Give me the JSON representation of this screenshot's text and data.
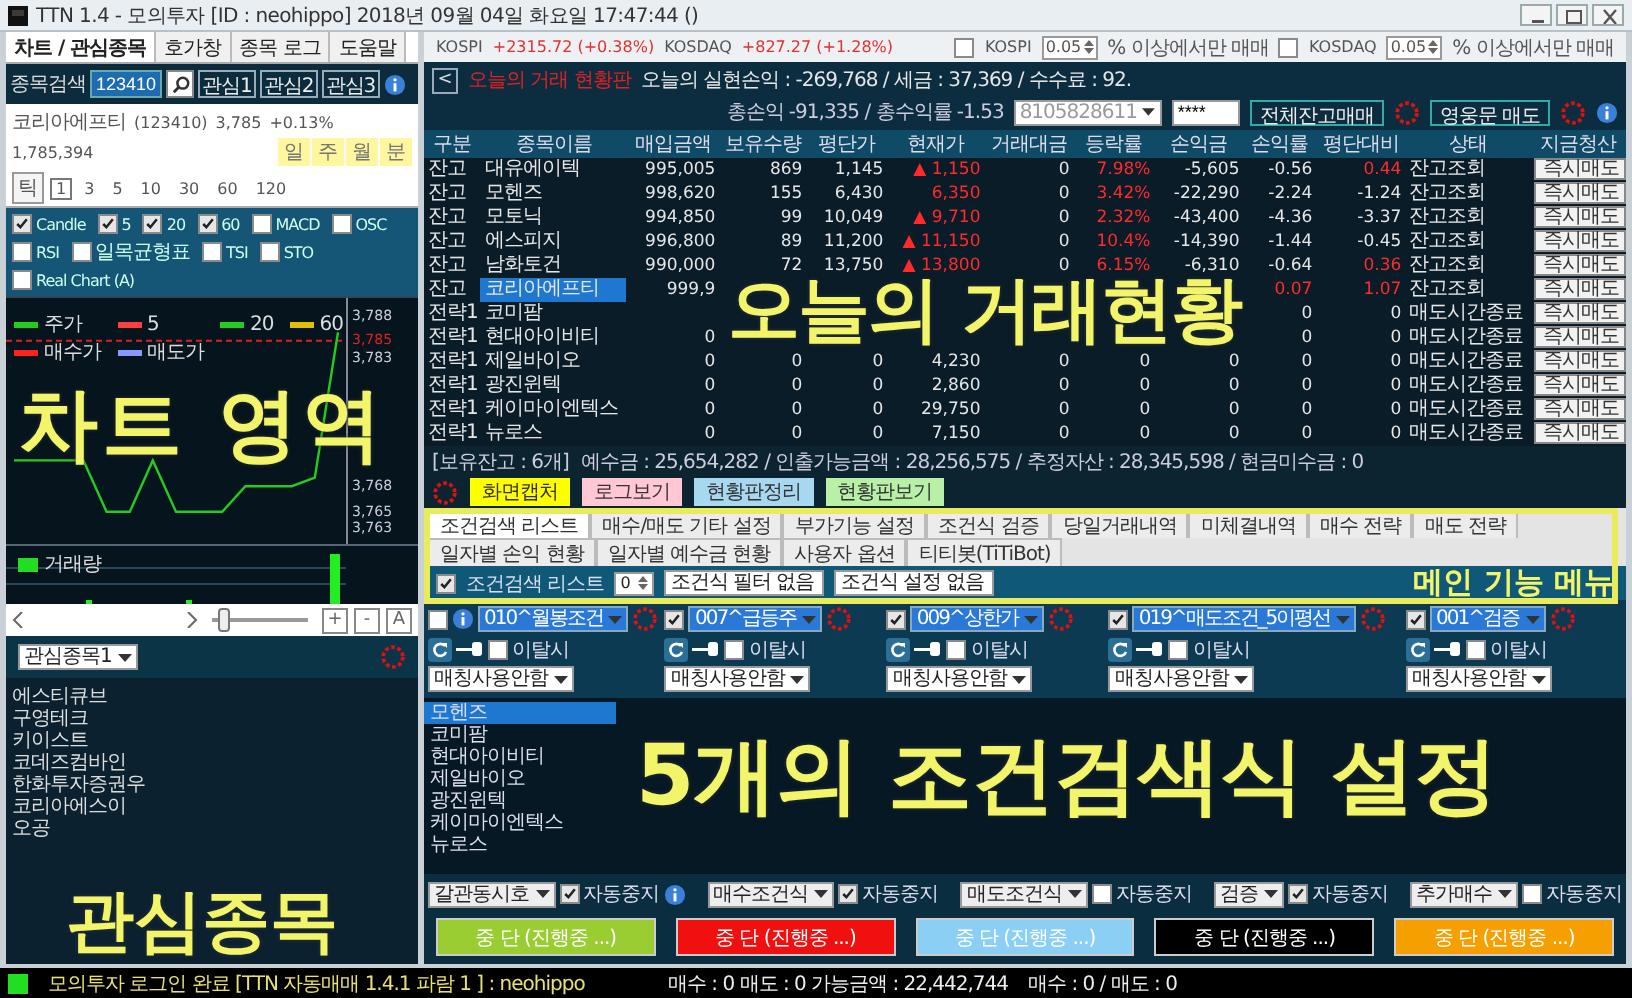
{
  "window": {
    "title": "TTN 1.4 - 모의투자 [ID : neohippo] 2018년 09월 04일 화요일 17:47:44 ()"
  },
  "left_tabs": [
    {
      "label": "차트 / 관심종목",
      "selected": true
    },
    {
      "label": "호가창",
      "selected": false
    },
    {
      "label": "종목 로그",
      "selected": false
    },
    {
      "label": "도움말",
      "selected": false
    }
  ],
  "stock_search": {
    "label": "종목검색",
    "value": "123410",
    "buttons": [
      "관심1",
      "관심2",
      "관심3"
    ]
  },
  "stock_info": {
    "name": "코리아에프티",
    "code": "(123410)",
    "price": "3,785",
    "change": "+0.13%",
    "volume": "1,785,394",
    "periods": [
      "일",
      "주",
      "월",
      "분"
    ]
  },
  "tick_button": "틱",
  "intervals": [
    {
      "label": "1",
      "selected": true
    },
    {
      "label": "3",
      "selected": false
    },
    {
      "label": "5",
      "selected": false
    },
    {
      "label": "10",
      "selected": false
    },
    {
      "label": "30",
      "selected": false
    },
    {
      "label": "60",
      "selected": false
    },
    {
      "label": "120",
      "selected": false
    }
  ],
  "indicators": [
    {
      "label": "Candle",
      "checked": true
    },
    {
      "label": "5",
      "checked": true
    },
    {
      "label": "20",
      "checked": true
    },
    {
      "label": "60",
      "checked": true
    },
    {
      "label": "MACD",
      "checked": false
    },
    {
      "label": "OSC",
      "checked": false
    },
    {
      "label": "RSI",
      "checked": false
    },
    {
      "label": "일목균형표",
      "checked": false
    },
    {
      "label": "TSI",
      "checked": false
    },
    {
      "label": "STO",
      "checked": false
    },
    {
      "label": "Real Chart (A)",
      "checked": false
    }
  ],
  "chart": {
    "legend": [
      {
        "label": "주가",
        "color": "#22cc22"
      },
      {
        "label": "5",
        "color": "#ff4040"
      },
      {
        "label": "20",
        "color": "#22cc22"
      },
      {
        "label": "60",
        "color": "#e0c000"
      },
      {
        "label": "매수가",
        "color": "#ff2020"
      },
      {
        "label": "매도가",
        "color": "#8899ff"
      }
    ],
    "chart_data": {
      "type": "line",
      "ylim": [
        3761,
        3790
      ],
      "yticks": [
        {
          "value": 3788,
          "label": "3,788"
        },
        {
          "value": 3785,
          "label": "3,785"
        },
        {
          "value": 3783,
          "label": "3,783"
        },
        {
          "value": 3768,
          "label": "3,768"
        },
        {
          "value": 3765,
          "label": "3,765"
        },
        {
          "value": 3763,
          "label": "3,763"
        }
      ],
      "series": [
        {
          "color": "#22cc22",
          "values": [
            3771,
            3771,
            3771,
            3771,
            3765,
            3765,
            3771,
            3765,
            3765,
            3765,
            3768,
            3768,
            3768,
            3769,
            3786
          ]
        }
      ],
      "ref_lines": [
        {
          "axis": "y",
          "value": 3785,
          "color": "#e02020"
        }
      ]
    },
    "volume_label": "거래량"
  },
  "zoom_slider": {
    "level": 0.12
  },
  "zoom_buttons": [
    "+",
    "-",
    "A"
  ],
  "watchlist": {
    "group": "관심종목1",
    "items": [
      "에스티큐브",
      "구영테크",
      "키이스트",
      "코데즈컴바인",
      "한화투자증권우",
      "코리아에스이",
      "오공"
    ]
  },
  "market_bar": {
    "indices": [
      {
        "name": "KOSPI",
        "value": "+2315.72 (+0.38%)"
      },
      {
        "name": "KOSDAQ",
        "value": "+827.27 (+1.28%)"
      }
    ],
    "filters": [
      {
        "label": "KOSPI",
        "checked": false,
        "value": "0.05",
        "suffix": "% 이상에서만 매매"
      },
      {
        "label": "KOSDAQ",
        "checked": false,
        "value": "0.05",
        "suffix": "% 이상에서만 매매"
      }
    ]
  },
  "board": {
    "back": "<",
    "title": "오늘의 거래 현황판",
    "realized": "오늘의 실현손익 : -269,768 / 세금 : 37,369 / 수수료 : 92.",
    "total": "총손익 -91,335 / 총수익률 -1.53",
    "account": "8105828611",
    "password": "****",
    "buttons": [
      "전체잔고매매",
      "영웅문 매도"
    ],
    "columns": [
      "구분",
      "종목이름",
      "매입금액",
      "보유수량",
      "평단가",
      "현재가",
      "거래대금",
      "등락률",
      "손익금",
      "손익률",
      "평단대비",
      "상태",
      "지금청산"
    ],
    "rows": [
      {
        "selected": false,
        "action": "즉시매도",
        "cells": [
          "잔고",
          "대유에이텍",
          "995,005",
          "869",
          "1,145",
          {
            "text": "▲ 1,150",
            "rising": true
          },
          "0",
          {
            "text": "7.98%",
            "rising": true
          },
          "-5,605",
          "-0.56",
          {
            "text": "0.44",
            "rising": true
          },
          "잔고조회"
        ]
      },
      {
        "selected": false,
        "action": "즉시매도",
        "cells": [
          "잔고",
          "모헨즈",
          "998,620",
          "155",
          "6,430",
          {
            "text": "6,350",
            "rising": true
          },
          "0",
          {
            "text": "3.42%",
            "rising": true
          },
          "-22,290",
          "-2.24",
          "-1.24",
          "잔고조회"
        ]
      },
      {
        "selected": false,
        "action": "즉시매도",
        "cells": [
          "잔고",
          "모토닉",
          "994,850",
          "99",
          "10,049",
          {
            "text": "▲ 9,710",
            "rising": true
          },
          "0",
          {
            "text": "2.32%",
            "rising": true
          },
          "-43,400",
          "-4.36",
          "-3.37",
          "잔고조회"
        ]
      },
      {
        "selected": false,
        "action": "즉시매도",
        "cells": [
          "잔고",
          "에스피지",
          "996,800",
          "89",
          "11,200",
          {
            "text": "▲ 11,150",
            "rising": true
          },
          "0",
          {
            "text": "10.4%",
            "rising": true
          },
          "-14,390",
          "-1.44",
          "-0.45",
          "잔고조회"
        ]
      },
      {
        "selected": false,
        "action": "즉시매도",
        "cells": [
          "잔고",
          "남화토건",
          "990,000",
          "72",
          "13,750",
          {
            "text": "▲ 13,800",
            "rising": true
          },
          "0",
          {
            "text": "6.15%",
            "rising": true
          },
          "-6,310",
          "-0.64",
          {
            "text": "0.36",
            "rising": true
          },
          "잔고조회"
        ]
      },
      {
        "selected": true,
        "action": "즉시매도",
        "cells": [
          "잔고",
          "코리아에프티",
          "999,9",
          null,
          null,
          null,
          null,
          null,
          null,
          {
            "text": "0.07",
            "rising": true
          },
          {
            "text": "1.07",
            "rising": true
          },
          "잔고조회"
        ]
      },
      {
        "selected": false,
        "action": "즉시매도",
        "cells": [
          "전략1",
          "코미팜",
          null,
          null,
          null,
          null,
          null,
          null,
          null,
          "0",
          "0",
          "매도시간종료"
        ]
      },
      {
        "selected": false,
        "action": "즉시매도",
        "cells": [
          "전략1",
          "현대아이비티",
          "0",
          null,
          null,
          null,
          null,
          null,
          null,
          "0",
          "0",
          "매도시간종료"
        ]
      },
      {
        "selected": false,
        "action": "즉시매도",
        "cells": [
          "전략1",
          "제일바이오",
          "0",
          "0",
          "0",
          "4,230",
          "0",
          "0",
          "0",
          "0",
          "0",
          "매도시간종료"
        ]
      },
      {
        "selected": false,
        "action": "즉시매도",
        "cells": [
          "전략1",
          "광진윈텍",
          "0",
          "0",
          "0",
          "2,860",
          "0",
          "0",
          "0",
          "0",
          "0",
          "매도시간종료"
        ]
      },
      {
        "selected": false,
        "action": "즉시매도",
        "cells": [
          "전략1",
          "케이마이엔텍스",
          "0",
          "0",
          "0",
          "29,750",
          "0",
          "0",
          "0",
          "0",
          "0",
          "매도시간종료"
        ]
      },
      {
        "selected": false,
        "action": "즉시매도",
        "cells": [
          "전략1",
          "뉴로스",
          "0",
          "0",
          "0",
          "7,150",
          "0",
          "0",
          "0",
          "0",
          "0",
          "매도시간종료"
        ]
      }
    ],
    "holdings": "[보유잔고 : 6개]",
    "summary": "예수금 : 25,654,282 / 인출가능금액 : 28,256,575 / 추정자산 : 28,345,598 / 현금미수금 : 0",
    "tools": [
      {
        "label": "화면캡처",
        "color": "#ffff00"
      },
      {
        "label": "로그보기",
        "color": "#ffc8d4"
      },
      {
        "label": "현황판정리",
        "color": "#a8d8f0"
      },
      {
        "label": "현황판보기",
        "color": "#b8f0a8"
      }
    ]
  },
  "conditions": {
    "tabs": [
      {
        "label": "조건검색 리스트",
        "selected": true
      },
      {
        "label": "매수/매도 기타 설정",
        "selected": false
      },
      {
        "label": "부가기능 설정",
        "selected": false
      },
      {
        "label": "조건식 검증",
        "selected": false
      },
      {
        "label": "당일거래내역",
        "selected": false
      },
      {
        "label": "미체결내역",
        "selected": false
      },
      {
        "label": "매수 전략",
        "selected": false
      },
      {
        "label": "매도 전략",
        "selected": false
      },
      {
        "label": "일자별 손익 현황",
        "selected": false
      },
      {
        "label": "일자별 예수금 현황",
        "selected": false
      },
      {
        "label": "사용자 옵션",
        "selected": false
      },
      {
        "label": "티티봇(TiTiBot)",
        "selected": false
      }
    ],
    "list_toggle": {
      "checked": true,
      "label": "조건검색 리스트"
    },
    "count": "0",
    "filter": "조건식 필터 없음",
    "setting": "조건식 설정 없음",
    "slots": [
      {
        "info": true,
        "checked": false,
        "formula": "010^월봉조건",
        "exit_checked": false,
        "exit_label": "이탈시",
        "matching": "매칭사용안함",
        "mode": "갈관동시호",
        "auto_stop": true,
        "auto_label": "자동중지",
        "button": "중 단 (진행중 ...)",
        "color": "#9acd32"
      },
      {
        "info": false,
        "checked": true,
        "formula": "007^급등주",
        "exit_checked": false,
        "exit_label": "이탈시",
        "matching": "매칭사용안함",
        "mode": "매수조건식",
        "auto_stop": true,
        "auto_label": "자동중지",
        "button": "중 단 (진행중 ...)",
        "color": "#f01010"
      },
      {
        "info": false,
        "checked": true,
        "formula": "009^상한가",
        "exit_checked": false,
        "exit_label": "이탈시",
        "matching": "매칭사용안함",
        "mode": "매도조건식",
        "auto_stop": false,
        "auto_label": "자동중지",
        "button": "중 단 (진행중 ...)",
        "color": "#8ccff5"
      },
      {
        "info": false,
        "checked": true,
        "formula": "019^매도조건_5이평선",
        "exit_checked": false,
        "exit_label": "이탈시",
        "matching": "매칭사용안함",
        "mode": "검증",
        "auto_stop": true,
        "auto_label": "자동중지",
        "button": "중 단 (진행중 ...)",
        "color": "#000000"
      },
      {
        "info": false,
        "checked": true,
        "formula": "001^검증",
        "exit_checked": false,
        "exit_label": "이탈시",
        "matching": "매칭사용안함",
        "mode": "추가매수",
        "auto_stop": false,
        "auto_label": "자동중지",
        "button": "중 단 (진행중 ...)",
        "color": "#f5a000"
      }
    ],
    "stocks": [
      {
        "name": "모헨즈",
        "selected": true
      },
      {
        "name": "코미팜",
        "selected": false
      },
      {
        "name": "현대아이비티",
        "selected": false
      },
      {
        "name": "제일바이오",
        "selected": false
      },
      {
        "name": "광진윈텍",
        "selected": false
      },
      {
        "name": "케이마이엔텍스",
        "selected": false
      },
      {
        "name": "뉴로스",
        "selected": false
      }
    ]
  },
  "status_bar": {
    "login": "모의투자 로그인 완료 [TTN 자동매매 1.4.1 파람 1 ] : neohippo",
    "orders": "매수 : 0 매도 : 0 가능금액 : 22,442,744",
    "counts": "매수 : 0 / 매도 : 0"
  },
  "annotations": [
    {
      "text": "차트 영역"
    },
    {
      "text": "오늘의 거래현황"
    },
    {
      "text": "관심종목"
    },
    {
      "text": "5개의 조건검색식 설정"
    },
    {
      "text": "메인 기능 메뉴"
    }
  ]
}
